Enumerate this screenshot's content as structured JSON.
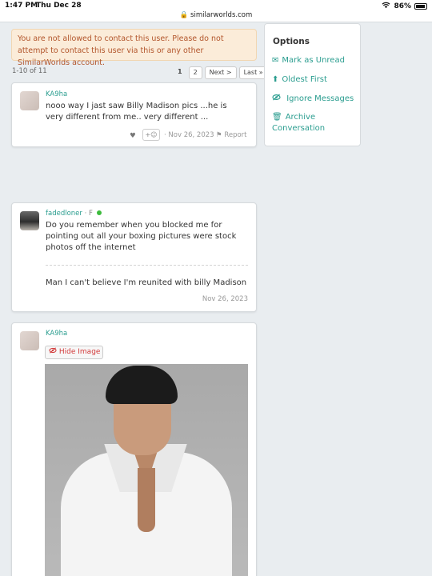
{
  "status_bar": {
    "time": "1:47 PM",
    "date": "Thu Dec 28",
    "url": "similarworlds.com",
    "battery": "86%"
  },
  "warning": {
    "text": "You are not allowed to contact this user. Please do not attempt to contact this user via this or any other SimilarWorlds account."
  },
  "pager": {
    "count": "1-10 of 11",
    "pages": [
      "1",
      "2"
    ],
    "next_label": "Next >",
    "last_label": "Last »"
  },
  "options": {
    "title": "Options",
    "items": [
      {
        "label": "Mark as Unread",
        "icon": "envelope-icon"
      },
      {
        "label": "Oldest First",
        "icon": "arrow-up-icon"
      },
      {
        "label": "Ignore Messages",
        "icon": "eye-slash-icon"
      },
      {
        "label": "Archive Conversation",
        "icon": "trash-icon"
      }
    ]
  },
  "messages": [
    {
      "username": "KA9ha",
      "text": "nooo way I jast saw Billy Madison pics ...he is very different from me.. very different ...",
      "react_label": "+☺",
      "date": "· Nov 26, 2023",
      "report_label": "Report"
    },
    {
      "username": "fadedloner",
      "user_suffix": "· F",
      "online": true,
      "text": "Do you remember when you blocked me for pointing out all your boxing pictures were stock photos off the internet",
      "text2": "Man I can't believe I'm reunited with billy Madison",
      "date": "Nov 26, 2023"
    },
    {
      "username": "KA9ha",
      "hide_image_label": "Hide Image"
    }
  ],
  "colors": {
    "accent": "#2a9d8f",
    "warning_bg": "#fbecd9",
    "warning_text": "#b2552b",
    "online_dot": "#3dbb3d",
    "hide_red": "#d23a3a"
  }
}
